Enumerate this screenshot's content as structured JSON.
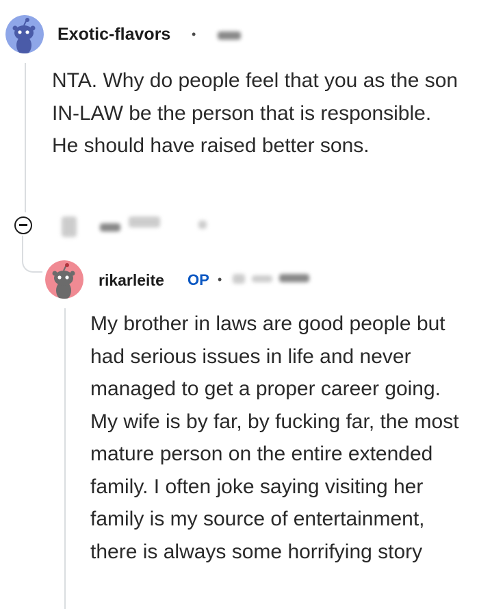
{
  "comments": [
    {
      "username": "Exotic-flavors",
      "avatar_color": "#8ea6e8",
      "body": "NTA. Why do people feel that you as the son IN-LAW be the person that is responsible. He should have raised better sons."
    },
    {
      "username": "rikarleite",
      "badge": "OP",
      "avatar_color": "#f08a93",
      "body": "My brother in laws are good people but had serious issues in life and never managed to get a proper career going. My wife is by far, by fucking far, the most mature person on the entire extended family. I often joke saying visiting her family is my source of entertainment, there is always some horrifying story"
    }
  ],
  "separator": "•",
  "icons": {
    "collapse": "minus-circle-icon",
    "avatar": "snoo-avatar-icon"
  },
  "colors": {
    "op_badge": "#0a57c2",
    "thread_line": "#dadde0"
  }
}
